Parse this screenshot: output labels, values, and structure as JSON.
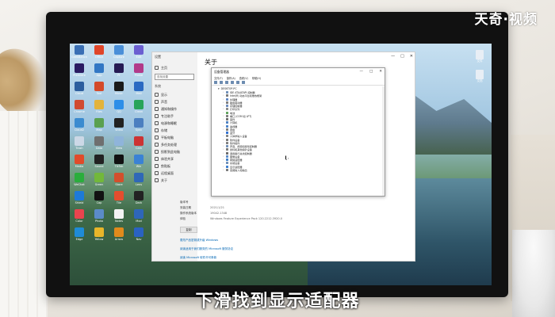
{
  "watermark": "天奇·视频",
  "caption": "下滑找到显示适配器",
  "desktop": {
    "icons": [
      {
        "label": "GeekBench",
        "color": "#3a6fb4"
      },
      {
        "label": "Office",
        "color": "#e0462a"
      },
      {
        "label": "Capture",
        "color": "#4a8fd8"
      },
      {
        "label": "Edit",
        "color": "#6b5fd1"
      },
      {
        "label": "Premiere",
        "color": "#2a1b62"
      },
      {
        "label": "App",
        "color": "#3277c4"
      },
      {
        "label": "Pr",
        "color": "#261b54"
      },
      {
        "label": "Pinkie",
        "color": "#b23a8a"
      },
      {
        "label": "Cloud",
        "color": "#2c5e9e"
      },
      {
        "label": "Tool",
        "color": "#d44a2a"
      },
      {
        "label": "Music",
        "color": "#1a1a1a"
      },
      {
        "label": "Mail",
        "color": "#2b6ac2"
      },
      {
        "label": "Chrome",
        "color": "#d14b31"
      },
      {
        "label": "Files",
        "color": "#e3b33b"
      },
      {
        "label": "QQ",
        "color": "#2d8ee8"
      },
      {
        "label": "Clean",
        "color": "#28a45a"
      },
      {
        "label": "Cloud2",
        "color": "#3b8bd0"
      },
      {
        "label": "Map",
        "color": "#5aa050"
      },
      {
        "label": "Video",
        "color": "#222"
      },
      {
        "label": "Sync",
        "color": "#4b7fc0"
      },
      {
        "label": "Trash",
        "color": "#ccd8e6"
      },
      {
        "label": "Data",
        "color": "#6f6f6f"
      },
      {
        "label": "View",
        "color": "#8fb4da"
      },
      {
        "label": "Cam",
        "color": "#c33"
      },
      {
        "label": "Media",
        "color": "#e04b2a"
      },
      {
        "label": "Sound",
        "color": "#222"
      },
      {
        "label": "TikTok",
        "color": "#111"
      },
      {
        "label": "Win",
        "color": "#3a82d5"
      },
      {
        "label": "WeChat",
        "color": "#2aae3c"
      },
      {
        "label": "Green",
        "color": "#72b83a"
      },
      {
        "label": "Store",
        "color": "#d34f2c"
      },
      {
        "label": "Lens",
        "color": "#2f68b7"
      },
      {
        "label": "Shield",
        "color": "#1d7ad8"
      },
      {
        "label": "Cap",
        "color": "#111"
      },
      {
        "label": "Tile",
        "color": "#e44d2e"
      },
      {
        "label": "Dark",
        "color": "#222"
      },
      {
        "label": "Color",
        "color": "#e9444e"
      },
      {
        "label": "Photo",
        "color": "#5b8bc8"
      },
      {
        "label": "Notes",
        "color": "#f3f3f3"
      },
      {
        "label": "Mod",
        "color": "#2e66b9"
      },
      {
        "label": "Edge",
        "color": "#1f8bd6"
      },
      {
        "label": "Yellow",
        "color": "#e8b52a"
      },
      {
        "label": "Arrow",
        "color": "#e18a1c"
      },
      {
        "label": "Nav",
        "color": "#2a62c2"
      }
    ],
    "right_icons": [
      {
        "label": "文件",
        "color": "#e8eef5"
      },
      {
        "label": "文档",
        "color": "#e8eef5"
      }
    ]
  },
  "settings": {
    "window_title": "设置",
    "home": "主页",
    "search_placeholder": "查找设置",
    "section": "系统",
    "side_items": [
      "显示",
      "声音",
      "通知和操作",
      "专注助手",
      "电源和睡眠",
      "存储",
      "平板电脑",
      "多任务处理",
      "投影到此电脑",
      "体验共享",
      "剪贴板",
      "远程桌面",
      "关于"
    ],
    "page_title": "关于",
    "related": [
      "BitLocker 设置",
      "设备管理器",
      "远程桌面",
      "系统保护",
      "高级系统设置",
      "重命名这台电脑"
    ],
    "specs": [
      {
        "k": "版本号",
        "v": ""
      },
      {
        "k": "安装日期",
        "v": "2021/1/21"
      },
      {
        "k": "操作系统版本",
        "v": "19042.1348"
      },
      {
        "k": "体验",
        "v": "Windows Feature Experience Pack 120.2212.3920.0"
      }
    ],
    "copy_label": "复制",
    "links": [
      "更改产品密钥或升级 Windows",
      "阅读适用于我们服务的 Microsoft 服务协议",
      "阅读 Microsoft 软件许可条款"
    ],
    "controls": {
      "min": "—",
      "max": "□",
      "close": "✕"
    }
  },
  "devmgr": {
    "title": "设备管理器",
    "menu": [
      "文件(F)",
      "操作(A)",
      "查看(V)",
      "帮助(H)"
    ],
    "root": "DESKTOP-PC",
    "items": [
      {
        "label": "IDE ATA/ATAPI 控制器",
        "color": "#6f8fb8"
      },
      {
        "label": "Intel(R) 动态平台和散热框架",
        "color": "#7a7a7a"
      },
      {
        "label": "处理器",
        "color": "#5f86c4"
      },
      {
        "label": "磁盘驱动器",
        "color": "#7c7c7c"
      },
      {
        "label": "存储控制器",
        "color": "#6b8bbd"
      },
      {
        "label": "打印队列",
        "color": "#8a8a8a"
      },
      {
        "label": "电池",
        "color": "#5fa25c"
      },
      {
        "label": "端口 (COM 和 LPT)",
        "color": "#7d7d7d"
      },
      {
        "label": "固件",
        "color": "#6d6d6d"
      },
      {
        "label": "计算机",
        "color": "#4b7fc0"
      },
      {
        "label": "监视器",
        "color": "#4a82c9"
      },
      {
        "label": "键盘",
        "color": "#7a7a7a"
      },
      {
        "label": "蓝牙",
        "color": "#2f6fd0"
      },
      {
        "label": "人体学输入设备",
        "color": "#858585"
      },
      {
        "label": "软件设备",
        "color": "#7a7a7a"
      },
      {
        "label": "软件组件",
        "color": "#7f7f7f"
      },
      {
        "label": "声音、视频和游戏控制器",
        "color": "#6f8fb8"
      },
      {
        "label": "鼠标和其他指针设备",
        "color": "#7a7a7a"
      },
      {
        "label": "通用串行总线控制器",
        "color": "#6a6a6a"
      },
      {
        "label": "图像设备",
        "color": "#5b8bc8"
      },
      {
        "label": "网络适配器",
        "color": "#3d7dc8"
      },
      {
        "label": "系统设备",
        "color": "#6f8fb8"
      },
      {
        "label": "显示适配器",
        "color": "#3c7fd0"
      },
      {
        "label": "音频输入和输出",
        "color": "#7a7a7a"
      }
    ],
    "controls": {
      "min": "—",
      "max": "□",
      "close": "✕"
    }
  }
}
